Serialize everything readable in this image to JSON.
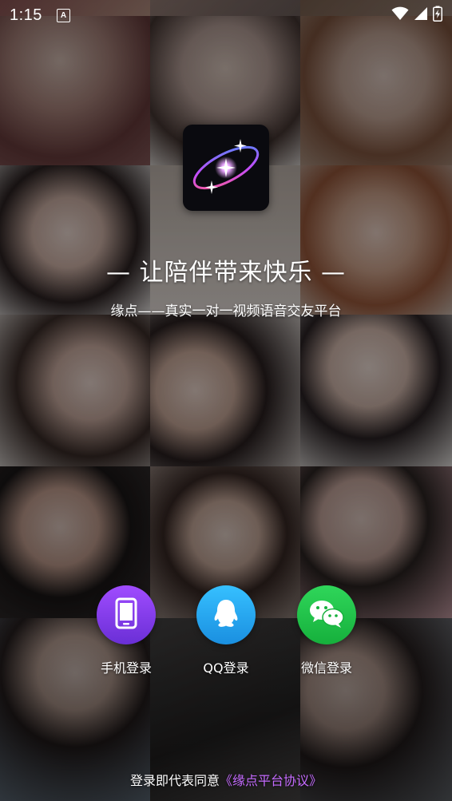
{
  "status_bar": {
    "time": "1:15",
    "a_icon_label": "A"
  },
  "branding": {
    "slogan": "— 让陪伴带来快乐 —",
    "subtitle": "缘点——真实一对一视频语音交友平台"
  },
  "login_options": [
    {
      "label": "手机登录",
      "icon": "phone-icon",
      "color": "#8a3df0"
    },
    {
      "label": "QQ登录",
      "icon": "qq-icon",
      "color": "#1fa7e8"
    },
    {
      "label": "微信登录",
      "icon": "wechat-icon",
      "color": "#22c24a"
    }
  ],
  "agreement": {
    "prefix": "登录即代表同意",
    "link": "《缘点平台协议》"
  },
  "colors": {
    "accent_link": "#c56bff",
    "phone_button": "#8a3df0",
    "qq_button": "#1fa7e8",
    "wechat_button": "#22c24a"
  }
}
